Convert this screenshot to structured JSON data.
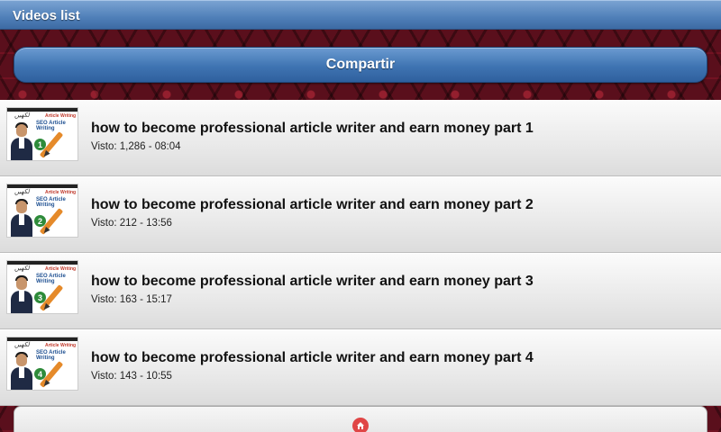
{
  "header": {
    "title": "Videos list"
  },
  "share_button": {
    "label": "Compartir"
  },
  "videos": [
    {
      "title": "how to become professional article writer and earn money part 1",
      "meta": "Visto: 1,286 - 08:04",
      "thumb": {
        "number": "1",
        "script": "ﻟﮑﮭﯿﮟ",
        "tag": "Article Writing",
        "seo": "SEO Article Writing"
      }
    },
    {
      "title": "how to become professional article writer and earn money part 2",
      "meta": "Visto: 212 - 13:56",
      "thumb": {
        "number": "2",
        "script": "ﻟﮑﮭﯿﮟ",
        "tag": "Article Writing",
        "seo": "SEO Article Writing"
      }
    },
    {
      "title": "how to become professional article writer and earn money part 3",
      "meta": "Visto: 163 - 15:17",
      "thumb": {
        "number": "3",
        "script": "ﻟﮑﮭﯿﮟ",
        "tag": "Article Writing",
        "seo": "SEO Article Writing"
      }
    },
    {
      "title": "how to become professional article writer and earn money part 4",
      "meta": "Visto: 143 - 10:55",
      "thumb": {
        "number": "4",
        "script": "ﻟﮑﮭﯿﮟ",
        "tag": "Article Writing",
        "seo": "SEO Article Writing"
      }
    }
  ],
  "footer": {
    "icon": "home-icon",
    "icon_color": "#e04646"
  },
  "colors": {
    "header": "#4f7fb8",
    "button": "#3f74b2",
    "background": "#5a0f1c"
  }
}
